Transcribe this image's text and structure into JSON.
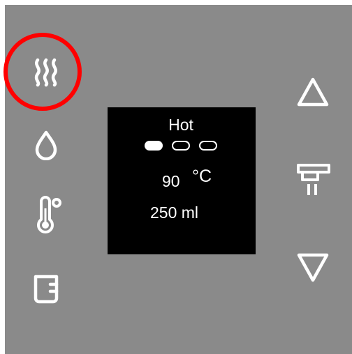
{
  "colors": {
    "panel_bg": "#8a8a8a",
    "screen_bg": "#000000",
    "icon": "#ffffff",
    "highlight_ring": "#ff0000"
  },
  "left_buttons": [
    {
      "icon": "heat-waves-icon",
      "selected": true
    },
    {
      "icon": "water-drop-icon",
      "selected": false
    },
    {
      "icon": "thermometer-icon",
      "selected": false
    },
    {
      "icon": "cup-icon",
      "selected": false
    }
  ],
  "right_buttons": [
    {
      "icon": "up-triangle-icon"
    },
    {
      "icon": "dispense-tap-icon"
    },
    {
      "icon": "down-triangle-icon"
    }
  ],
  "display": {
    "mode": "Hot",
    "level_indicator": {
      "active": 1,
      "total": 3
    },
    "temperature_value": "90",
    "temperature_unit": "°C",
    "volume": "250 ml"
  }
}
